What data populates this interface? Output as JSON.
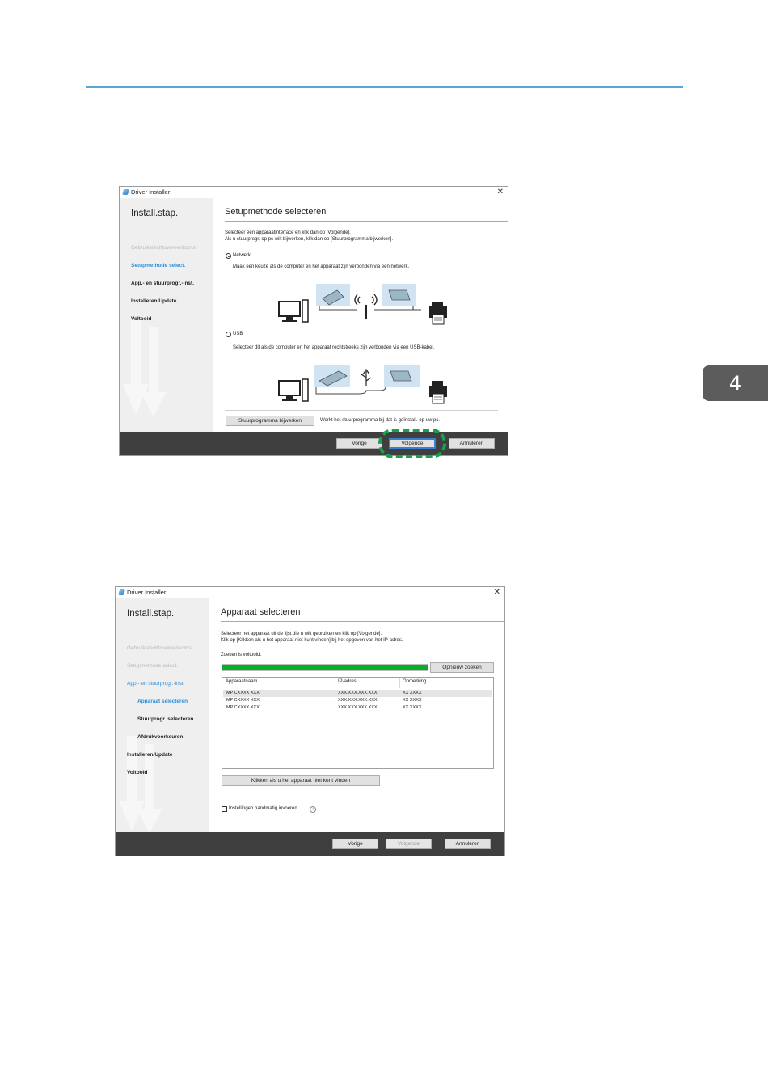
{
  "page": {
    "chapter_tab": "4"
  },
  "window1": {
    "title": "Driver Installer",
    "close": "✕",
    "sidebar": {
      "title": "Install.stap.",
      "steps": [
        {
          "label": "Gebruiksrechtovereenkomst",
          "state": "done"
        },
        {
          "label": "Setupmethode select.",
          "state": "active"
        },
        {
          "label": "App.- en stuurprogr.-inst.",
          "state": "pending"
        },
        {
          "label": "Installeren/Update",
          "state": "pending"
        },
        {
          "label": "Voltooid",
          "state": "pending"
        }
      ]
    },
    "main": {
      "title": "Setupmethode selecteren",
      "instruction1": "Selecteer een apparaatinterface en klik dan op [Volgende].",
      "instruction2": "Als u stuurprogr. op pc wilt bijwerken, klik dan op [Stuurprogramma bijwerken].",
      "network_label": "Netwerk",
      "network_desc": "Maak een keuze als de computer en het apparaat zijn verbonden via een netwerk.",
      "usb_label": "USB",
      "usb_desc": "Selecteer dit als de computer en het apparaat rechtstreeks zijn verbonden via een USB-kabel.",
      "update_button": "Stuurprogramma bijwerken",
      "update_desc": "Werkt het stuurprogramma bij dat is geïnstall. op uw pc."
    },
    "footer": {
      "back": "Vorige",
      "next": "Volgende",
      "cancel": "Annuleren"
    }
  },
  "window2": {
    "title": "Driver Installer",
    "close": "✕",
    "sidebar": {
      "title": "Install.stap.",
      "steps": [
        {
          "label": "Gebruiksrechtovereenkomst",
          "state": "done"
        },
        {
          "label": "Setupmethode select.",
          "state": "done"
        },
        {
          "label": "App.- en stuurprogr.-inst.",
          "state": "current-parent"
        },
        {
          "label": "Apparaat selecteren",
          "state": "active-sub"
        },
        {
          "label": "Stuurprogr. selecteren",
          "state": "sub"
        },
        {
          "label": "Afdrukvoorkeuren",
          "state": "sub"
        },
        {
          "label": "Installeren/Update",
          "state": "pending"
        },
        {
          "label": "Voltooid",
          "state": "pending"
        }
      ]
    },
    "main": {
      "title": "Apparaat selecteren",
      "instruction1": "Selecteer het apparaat uit de lijst die u wilt gebruiken en klik op [Volgende].",
      "instruction2": "Klik op [Klikken als u het apparaat niet kunt vinden] bij het opgeven van het IP-adres.",
      "status": "Zoeken is voltooid.",
      "progress": 1.0,
      "research_button": "Opnieuw zoeken",
      "columns": [
        "Apparaatnaam",
        "IP-adres",
        "Opmerking"
      ],
      "rows": [
        [
          "MP CXXXX XXX",
          "XXX.XXX.XXX.XXX",
          "XX XXXX"
        ],
        [
          "MP CXXXX XXX",
          "XXX.XXX.XXX.XXX",
          "XX XXXX"
        ],
        [
          "MP CXXXX XXX",
          "XXX.XXX.XXX.XXX",
          "XX XXXX"
        ]
      ],
      "not_found_button": "Klikken als u het apparaat niet kunt vinden",
      "manual_checkbox": "Instellingen handmatig invoeren",
      "manual_checked": false,
      "info_icon": "i"
    },
    "footer": {
      "back": "Vorige",
      "next": "Volgende",
      "cancel": "Annuleren"
    }
  },
  "colors": {
    "accent": "#2e8fd8",
    "progress": "#06b025",
    "highlight": "#19a050",
    "footer": "#3f3f3f"
  }
}
